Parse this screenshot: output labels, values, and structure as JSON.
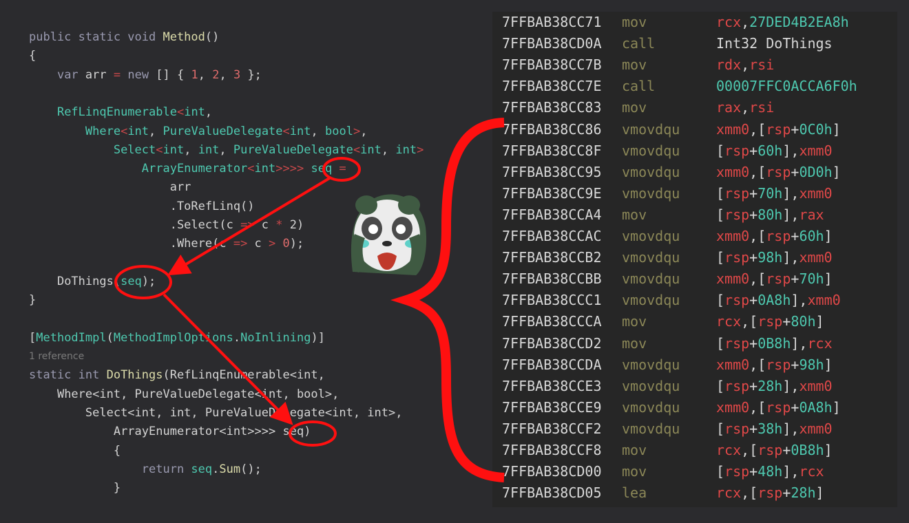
{
  "colors": {
    "background": "#2b2b2e",
    "asm_background": "#262626",
    "keyword": "#9a9ab0",
    "type": "#4ec9b0",
    "number": "#e06c6c",
    "operator": "#c8484a",
    "string": "#d4d4d4",
    "method": "#dcdcaa",
    "register": "#e04848",
    "hex": "#4ec9b0",
    "mnemonic": "#8b8757",
    "annotation": "#ff1010"
  },
  "code": {
    "lines": [
      {
        "tokens": [
          [
            "public static void ",
            "kw"
          ],
          [
            "Method",
            "mt"
          ],
          [
            "()",
            "p"
          ]
        ]
      },
      {
        "tokens": [
          [
            "{",
            "p"
          ]
        ]
      },
      {
        "tokens": [
          [
            "    ",
            "p"
          ],
          [
            "var ",
            "kw"
          ],
          [
            "arr ",
            "p"
          ],
          [
            "= ",
            "op"
          ],
          [
            "new ",
            "kw"
          ],
          [
            "[] { ",
            "p"
          ],
          [
            "1",
            "nm"
          ],
          [
            ", ",
            "p"
          ],
          [
            "2",
            "nm"
          ],
          [
            ", ",
            "p"
          ],
          [
            "3",
            "nm"
          ],
          [
            " };",
            "p"
          ]
        ]
      },
      {
        "tokens": []
      },
      {
        "tokens": [
          [
            "    ",
            "p"
          ],
          [
            "RefLinqEnumerable",
            "ty"
          ],
          [
            "<",
            "op"
          ],
          [
            "int",
            "ty"
          ],
          [
            ",",
            "p"
          ]
        ]
      },
      {
        "tokens": [
          [
            "        ",
            "p"
          ],
          [
            "Where",
            "ty"
          ],
          [
            "<",
            "op"
          ],
          [
            "int",
            "ty"
          ],
          [
            ", ",
            "p"
          ],
          [
            "PureValueDelegate",
            "ty"
          ],
          [
            "<",
            "op"
          ],
          [
            "int",
            "ty"
          ],
          [
            ", ",
            "p"
          ],
          [
            "bool",
            "ty"
          ],
          [
            ">",
            "op"
          ],
          [
            ",",
            "p"
          ]
        ]
      },
      {
        "tokens": [
          [
            "            ",
            "p"
          ],
          [
            "Select",
            "ty"
          ],
          [
            "<",
            "op"
          ],
          [
            "int",
            "ty"
          ],
          [
            ", ",
            "p"
          ],
          [
            "int",
            "ty"
          ],
          [
            ", ",
            "p"
          ],
          [
            "PureValueDelegate",
            "ty"
          ],
          [
            "<",
            "op"
          ],
          [
            "int",
            "ty"
          ],
          [
            ", ",
            "p"
          ],
          [
            "int",
            "ty"
          ],
          [
            ">",
            "op"
          ]
        ]
      },
      {
        "tokens": [
          [
            "                ",
            "p"
          ],
          [
            "ArrayEnumerator",
            "ty"
          ],
          [
            "<",
            "op"
          ],
          [
            "int",
            "ty"
          ],
          [
            ">>>>",
            "op"
          ],
          [
            " ",
            "p"
          ],
          [
            "seq",
            "ty"
          ],
          [
            " =",
            "op"
          ]
        ]
      },
      {
        "tokens": [
          [
            "                    ",
            "p"
          ],
          [
            "arr",
            "p"
          ]
        ]
      },
      {
        "tokens": [
          [
            "                    ",
            "p"
          ],
          [
            ".ToRefLinq()",
            "p"
          ]
        ]
      },
      {
        "tokens": [
          [
            "                    ",
            "p"
          ],
          [
            ".Select(c ",
            "p"
          ],
          [
            "=> ",
            "op"
          ],
          [
            "c ",
            "p"
          ],
          [
            "* ",
            "op"
          ],
          [
            "2)",
            "p"
          ]
        ]
      },
      {
        "tokens": [
          [
            "                    ",
            "p"
          ],
          [
            ".Where(c ",
            "p"
          ],
          [
            "=> ",
            "op"
          ],
          [
            "c ",
            "p"
          ],
          [
            "> ",
            "op"
          ],
          [
            "0",
            "nm"
          ],
          [
            ");",
            "p"
          ]
        ]
      },
      {
        "tokens": []
      },
      {
        "tokens": [
          [
            "    ",
            "p"
          ],
          [
            "DoThings",
            "p"
          ],
          [
            "(",
            "p"
          ],
          [
            "seq",
            "ty"
          ],
          [
            ");",
            "p"
          ]
        ]
      },
      {
        "tokens": [
          [
            "}",
            "p"
          ]
        ]
      },
      {
        "tokens": []
      },
      {
        "tokens": [
          [
            "[",
            "p"
          ],
          [
            "MethodImpl",
            "ty"
          ],
          [
            "(",
            "p"
          ],
          [
            "MethodImplOptions",
            "ty"
          ],
          [
            ".",
            "p"
          ],
          [
            "NoInlining",
            "ty"
          ],
          [
            ")]",
            "p"
          ]
        ]
      },
      {
        "ref": true,
        "tokens": [
          [
            "1 reference",
            "ref"
          ]
        ]
      },
      {
        "tokens": [
          [
            "static int ",
            "kw"
          ],
          [
            "DoThings",
            "mt"
          ],
          [
            "(RefLinqEnumerable<int,",
            "p"
          ]
        ]
      },
      {
        "tokens": [
          [
            "    ",
            "p"
          ],
          [
            "Where<int, PureValueDelegate<int, bool>,",
            "p"
          ]
        ]
      },
      {
        "tokens": [
          [
            "        ",
            "p"
          ],
          [
            "Select<int, int, PureValueDelegate<int, int>,",
            "p"
          ]
        ]
      },
      {
        "tokens": [
          [
            "            ",
            "p"
          ],
          [
            "ArrayEnumerator<int>>>> ",
            "p"
          ],
          [
            "seq",
            "p"
          ],
          [
            ")",
            "p"
          ]
        ]
      },
      {
        "tokens": [
          [
            "            ",
            "p"
          ],
          [
            "{",
            "p"
          ]
        ]
      },
      {
        "tokens": [
          [
            "                ",
            "p"
          ],
          [
            "return ",
            "kw"
          ],
          [
            "seq",
            "ty"
          ],
          [
            ".",
            "p"
          ],
          [
            "Sum",
            "mt"
          ],
          [
            "();",
            "p"
          ]
        ]
      },
      {
        "tokens": [
          [
            "            ",
            "p"
          ],
          [
            "}",
            "p"
          ]
        ]
      }
    ]
  },
  "asm": {
    "rows": [
      {
        "addr": "7FFBAB38CC71",
        "mn": "mov",
        "op": [
          [
            "rcx",
            "r"
          ],
          [
            ",",
            "p"
          ],
          [
            "27DED4B2EA8h",
            "h"
          ]
        ]
      },
      {
        "addr": "7FFBAB38CD0A",
        "mn": "call",
        "op": [
          [
            "Int32 DoThings",
            "p"
          ]
        ]
      },
      {
        "addr": "7FFBAB38CC7B",
        "mn": "mov",
        "op": [
          [
            "rdx",
            "r"
          ],
          [
            ",",
            "p"
          ],
          [
            "rsi",
            "r"
          ]
        ]
      },
      {
        "addr": "7FFBAB38CC7E",
        "mn": "call",
        "op": [
          [
            "00007FFC0ACCA6F0h",
            "h"
          ]
        ]
      },
      {
        "addr": "7FFBAB38CC83",
        "mn": "mov",
        "op": [
          [
            "rax",
            "r"
          ],
          [
            ",",
            "p"
          ],
          [
            "rsi",
            "r"
          ]
        ]
      },
      {
        "addr": "7FFBAB38CC86",
        "mn": "vmovdqu",
        "op": [
          [
            "xmm0",
            "r"
          ],
          [
            ",[",
            "p"
          ],
          [
            "rsp",
            "r"
          ],
          [
            "+",
            "p"
          ],
          [
            "0C0h",
            "h"
          ],
          [
            "]",
            "p"
          ]
        ]
      },
      {
        "addr": "7FFBAB38CC8F",
        "mn": "vmovdqu",
        "op": [
          [
            "[",
            "p"
          ],
          [
            "rsp",
            "r"
          ],
          [
            "+",
            "p"
          ],
          [
            "60h",
            "h"
          ],
          [
            "],",
            "p"
          ],
          [
            "xmm0",
            "r"
          ]
        ]
      },
      {
        "addr": "7FFBAB38CC95",
        "mn": "vmovdqu",
        "op": [
          [
            "xmm0",
            "r"
          ],
          [
            ",[",
            "p"
          ],
          [
            "rsp",
            "r"
          ],
          [
            "+",
            "p"
          ],
          [
            "0D0h",
            "h"
          ],
          [
            "]",
            "p"
          ]
        ]
      },
      {
        "addr": "7FFBAB38CC9E",
        "mn": "vmovdqu",
        "op": [
          [
            "[",
            "p"
          ],
          [
            "rsp",
            "r"
          ],
          [
            "+",
            "p"
          ],
          [
            "70h",
            "h"
          ],
          [
            "],",
            "p"
          ],
          [
            "xmm0",
            "r"
          ]
        ]
      },
      {
        "addr": "7FFBAB38CCA4",
        "mn": "mov",
        "op": [
          [
            "[",
            "p"
          ],
          [
            "rsp",
            "r"
          ],
          [
            "+",
            "p"
          ],
          [
            "80h",
            "h"
          ],
          [
            "],",
            "p"
          ],
          [
            "rax",
            "r"
          ]
        ]
      },
      {
        "addr": "7FFBAB38CCAC",
        "mn": "vmovdqu",
        "op": [
          [
            "xmm0",
            "r"
          ],
          [
            ",[",
            "p"
          ],
          [
            "rsp",
            "r"
          ],
          [
            "+",
            "p"
          ],
          [
            "60h",
            "h"
          ],
          [
            "]",
            "p"
          ]
        ]
      },
      {
        "addr": "7FFBAB38CCB2",
        "mn": "vmovdqu",
        "op": [
          [
            "[",
            "p"
          ],
          [
            "rsp",
            "r"
          ],
          [
            "+",
            "p"
          ],
          [
            "98h",
            "h"
          ],
          [
            "],",
            "p"
          ],
          [
            "xmm0",
            "r"
          ]
        ]
      },
      {
        "addr": "7FFBAB38CCBB",
        "mn": "vmovdqu",
        "op": [
          [
            "xmm0",
            "r"
          ],
          [
            ",[",
            "p"
          ],
          [
            "rsp",
            "r"
          ],
          [
            "+",
            "p"
          ],
          [
            "70h",
            "h"
          ],
          [
            "]",
            "p"
          ]
        ]
      },
      {
        "addr": "7FFBAB38CCC1",
        "mn": "vmovdqu",
        "op": [
          [
            "[",
            "p"
          ],
          [
            "rsp",
            "r"
          ],
          [
            "+",
            "p"
          ],
          [
            "0A8h",
            "h"
          ],
          [
            "],",
            "p"
          ],
          [
            "xmm0",
            "r"
          ]
        ]
      },
      {
        "addr": "7FFBAB38CCCA",
        "mn": "mov",
        "op": [
          [
            "rcx",
            "r"
          ],
          [
            ",[",
            "p"
          ],
          [
            "rsp",
            "r"
          ],
          [
            "+",
            "p"
          ],
          [
            "80h",
            "h"
          ],
          [
            "]",
            "p"
          ]
        ]
      },
      {
        "addr": "7FFBAB38CCD2",
        "mn": "mov",
        "op": [
          [
            "[",
            "p"
          ],
          [
            "rsp",
            "r"
          ],
          [
            "+",
            "p"
          ],
          [
            "0B8h",
            "h"
          ],
          [
            "],",
            "p"
          ],
          [
            "rcx",
            "r"
          ]
        ]
      },
      {
        "addr": "7FFBAB38CCDA",
        "mn": "vmovdqu",
        "op": [
          [
            "xmm0",
            "r"
          ],
          [
            ",[",
            "p"
          ],
          [
            "rsp",
            "r"
          ],
          [
            "+",
            "p"
          ],
          [
            "98h",
            "h"
          ],
          [
            "]",
            "p"
          ]
        ]
      },
      {
        "addr": "7FFBAB38CCE3",
        "mn": "vmovdqu",
        "op": [
          [
            "[",
            "p"
          ],
          [
            "rsp",
            "r"
          ],
          [
            "+",
            "p"
          ],
          [
            "28h",
            "h"
          ],
          [
            "],",
            "p"
          ],
          [
            "xmm0",
            "r"
          ]
        ]
      },
      {
        "addr": "7FFBAB38CCE9",
        "mn": "vmovdqu",
        "op": [
          [
            "xmm0",
            "r"
          ],
          [
            ",[",
            "p"
          ],
          [
            "rsp",
            "r"
          ],
          [
            "+",
            "p"
          ],
          [
            "0A8h",
            "h"
          ],
          [
            "]",
            "p"
          ]
        ]
      },
      {
        "addr": "7FFBAB38CCF2",
        "mn": "vmovdqu",
        "op": [
          [
            "[",
            "p"
          ],
          [
            "rsp",
            "r"
          ],
          [
            "+",
            "p"
          ],
          [
            "38h",
            "h"
          ],
          [
            "],",
            "p"
          ],
          [
            "xmm0",
            "r"
          ]
        ]
      },
      {
        "addr": "7FFBAB38CCF8",
        "mn": "mov",
        "op": [
          [
            "rcx",
            "r"
          ],
          [
            ",[",
            "p"
          ],
          [
            "rsp",
            "r"
          ],
          [
            "+",
            "p"
          ],
          [
            "0B8h",
            "h"
          ],
          [
            "]",
            "p"
          ]
        ]
      },
      {
        "addr": "7FFBAB38CD00",
        "mn": "mov",
        "op": [
          [
            "[",
            "p"
          ],
          [
            "rsp",
            "r"
          ],
          [
            "+",
            "p"
          ],
          [
            "48h",
            "h"
          ],
          [
            "],",
            "p"
          ],
          [
            "rcx",
            "r"
          ]
        ]
      },
      {
        "addr": "7FFBAB38CD05",
        "mn": "lea",
        "op": [
          [
            "rcx",
            "r"
          ],
          [
            ",[",
            "p"
          ],
          [
            "rsp",
            "r"
          ],
          [
            "+",
            "p"
          ],
          [
            "28h",
            "h"
          ],
          [
            "]",
            "p"
          ]
        ]
      }
    ]
  },
  "illustration": {
    "icon": "crying-panda-icon"
  }
}
